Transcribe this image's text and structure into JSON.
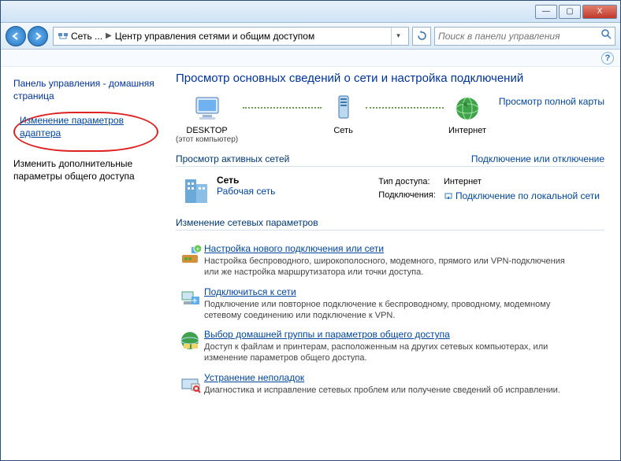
{
  "titlebar": {
    "min": "—",
    "max": "▢",
    "close": "X"
  },
  "toolbar": {
    "crumb1": "Сеть ...",
    "crumb2": "Центр управления сетями и общим доступом",
    "search_placeholder": "Поиск в панели управления"
  },
  "sidebar": {
    "home": "Панель управления - домашняя страница",
    "adapter": "Изменение параметров адаптера",
    "advanced": "Изменить дополнительные параметры общего доступа"
  },
  "main": {
    "heading": "Просмотр основных сведений о сети и настройка подключений",
    "map_link": "Просмотр полной карты",
    "node_desktop": "DESKTOP",
    "node_desktop_sub": "(этот компьютер)",
    "node_network": "Сеть",
    "node_internet": "Интернет",
    "active_hd": "Просмотр активных сетей",
    "active_link": "Подключение или отключение",
    "net_name": "Сеть",
    "net_kind": "Рабочая сеть",
    "prop_access_k": "Тип доступа:",
    "prop_access_v": "Интернет",
    "prop_conn_k": "Подключения:",
    "prop_conn_v": "Подключение по локальной сети",
    "change_hd": "Изменение сетевых параметров",
    "tasks": [
      {
        "title": "Настройка нового подключения или сети",
        "desc": "Настройка беспроводного, широкополосного, модемного, прямого или VPN-подключения или же настройка маршрутизатора или точки доступа."
      },
      {
        "title": "Подключиться к сети",
        "desc": "Подключение или повторное подключение к беспроводному, проводному, модемному сетевому соединению или подключение к VPN."
      },
      {
        "title": "Выбор домашней группы и параметров общего доступа",
        "desc": "Доступ к файлам и принтерам, расположенным на других сетевых компьютерах, или изменение параметров общего доступа."
      },
      {
        "title": "Устранение неполадок",
        "desc": "Диагностика и исправление сетевых проблем или получение сведений об исправлении."
      }
    ]
  }
}
